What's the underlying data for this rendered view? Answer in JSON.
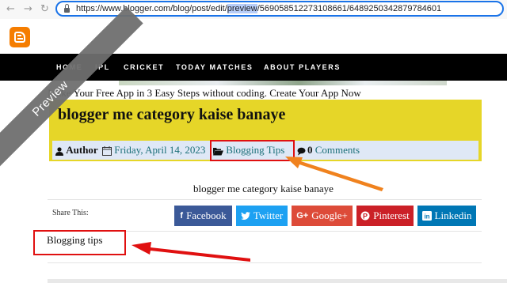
{
  "browser": {
    "url_prefix": "https://www.blogger.com/blog/post/edit/",
    "url_highlight": "preview",
    "url_suffix": "/5690585122731086​61/6489250342879784601"
  },
  "menu": [
    "HOME",
    "IPL",
    "CRICKET",
    "TODAY MATCHES",
    "ABOUT PLAYERS"
  ],
  "promo_text": "Make Your Free App in 3 Easy Steps without coding. Create Your App Now",
  "preview_ribbon": "Preview",
  "post": {
    "title": "blogger me category kaise banaye",
    "author": "Author",
    "date": "Friday, April 14, 2023",
    "category": "Blogging Tips",
    "comments_count": "0",
    "comments_label": "Comments",
    "body": "blogger me category kaise banaye"
  },
  "share": {
    "label": "Share This:",
    "buttons": [
      {
        "label": "Facebook",
        "color": "#3b5998",
        "icon": "f"
      },
      {
        "label": "Twitter",
        "color": "#1da1f2",
        "icon": "twitter-bird"
      },
      {
        "label": "Google+",
        "color": "#dd4b39",
        "icon": "G+"
      },
      {
        "label": "Pinterest",
        "color": "#cb2027",
        "icon": "pinterest-p"
      },
      {
        "label": "Linkedin",
        "color": "#0077b5",
        "icon": "in"
      }
    ]
  },
  "labels_text": "Blogging tips",
  "colors": {
    "accent_blue": "#1a73e8",
    "title_bg": "#e6d628",
    "annotation_red": "#e01010",
    "annotation_orange": "#f0821e"
  }
}
